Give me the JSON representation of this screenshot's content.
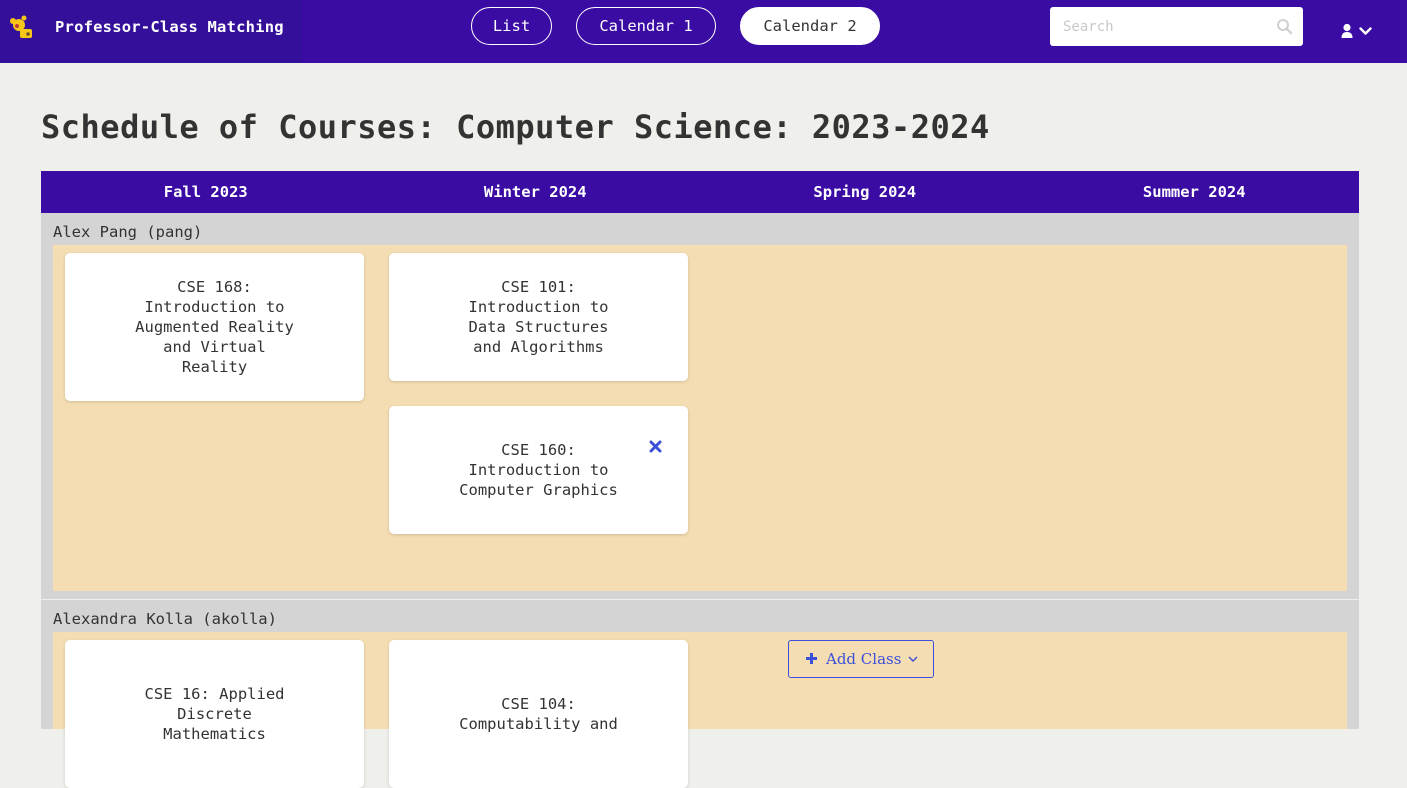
{
  "app": {
    "title": "Professor-Class Matching"
  },
  "nav": {
    "list_label": "List",
    "calendar1_label": "Calendar 1",
    "calendar2_label": "Calendar 2",
    "active": "Calendar 2"
  },
  "search": {
    "placeholder": "Search",
    "value": ""
  },
  "page": {
    "title": "Schedule of Courses: Computer Science: 2023-2024"
  },
  "terms": [
    "Fall 2023",
    "Winter 2024",
    "Spring 2024",
    "Summer 2024"
  ],
  "professors": [
    {
      "name": "Alex Pang (pang)",
      "courses": [
        {
          "term": "Fall 2023",
          "title": "CSE 168: Introduction to Augmented Reality and Virtual Reality",
          "removable": false
        },
        {
          "term": "Winter 2024",
          "title": "CSE 101: Introduction to Data Structures and Algorithms",
          "removable": false
        },
        {
          "term": "Winter 2024",
          "title": "CSE 160: Introduction to Computer Graphics",
          "removable": true
        }
      ]
    },
    {
      "name": "Alexandra Kolla (akolla)",
      "courses": [
        {
          "term": "Fall 2023",
          "title": "CSE 16: Applied Discrete Mathematics",
          "removable": false
        },
        {
          "term": "Winter 2024",
          "title": "CSE 104: Computability and",
          "removable": false
        }
      ],
      "add_class_label": "Add Class"
    }
  ],
  "colors": {
    "navbar": "#3b0ca3",
    "brand_bg": "#34109a",
    "term_header": "#3b0ca3",
    "row_bg": "#d4d4d4",
    "area_bg": "#f4ddb3",
    "accent": "#3b4fd8",
    "page_bg": "#efefeb"
  },
  "icons": [
    "app-logo-icon",
    "search-icon",
    "user-icon",
    "chevron-down-icon",
    "remove-icon",
    "plus-icon"
  ]
}
